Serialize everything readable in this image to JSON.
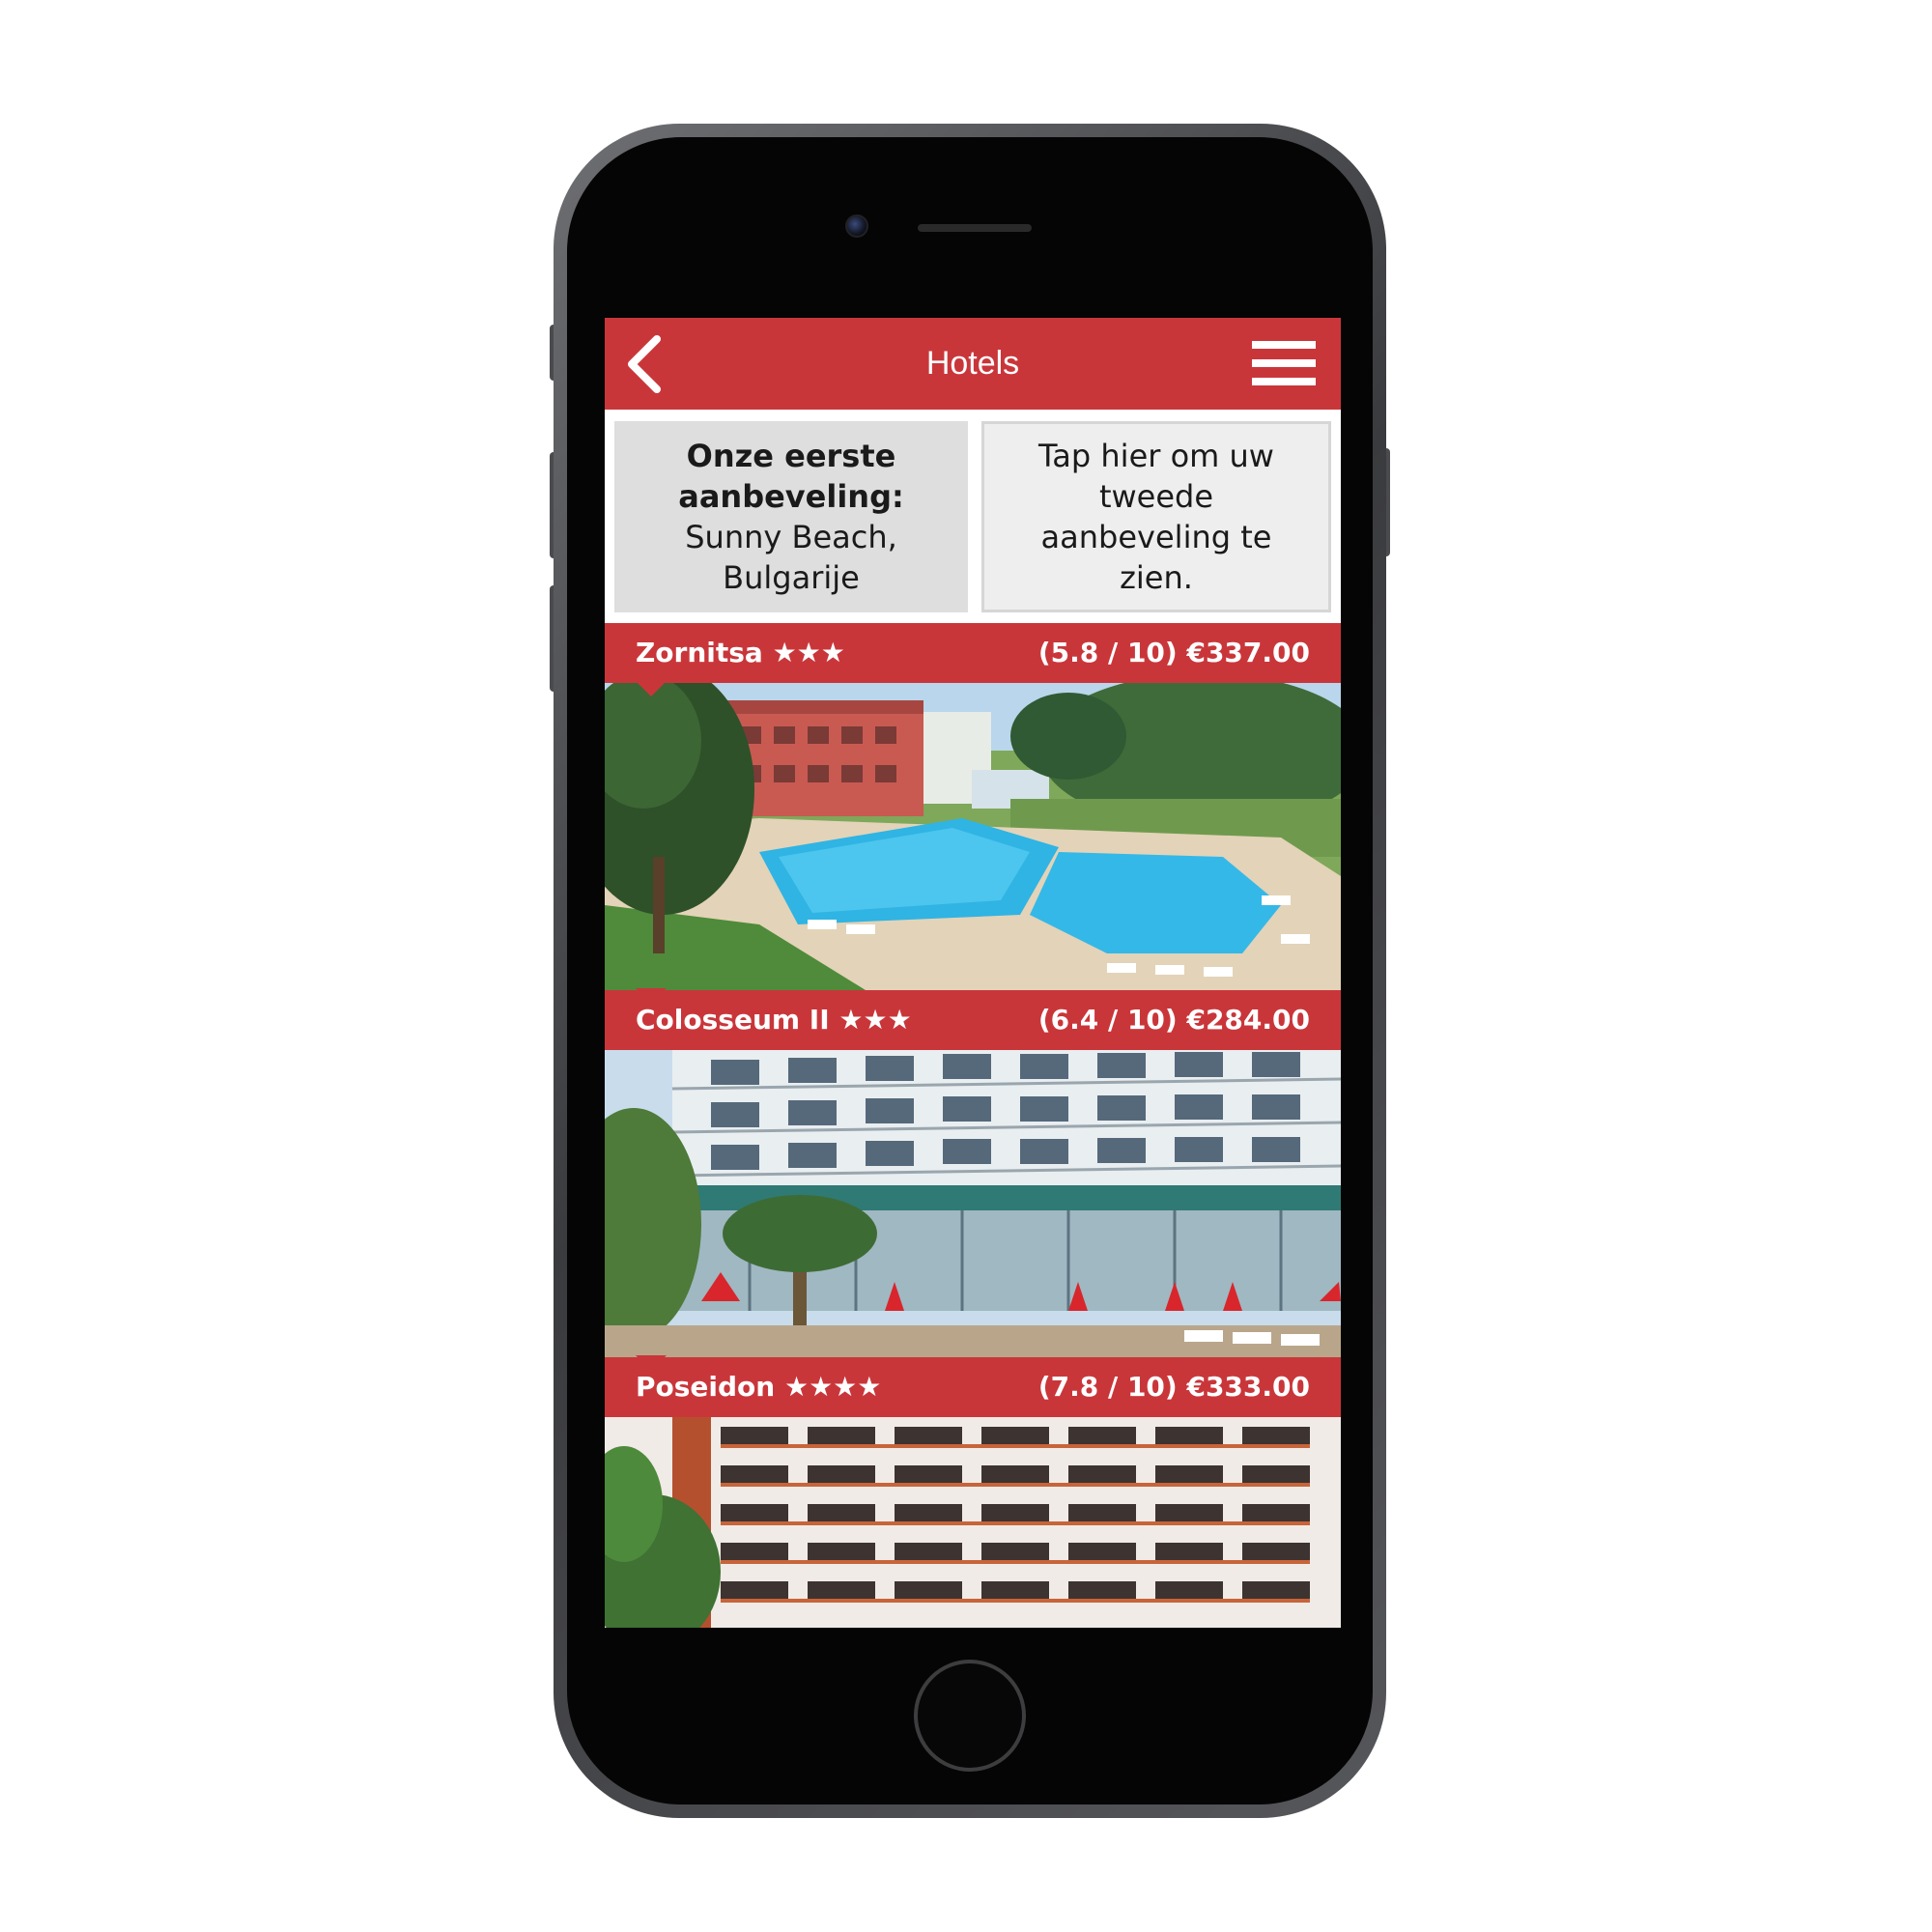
{
  "app": {
    "nav_title": "Hotels"
  },
  "recommendations": {
    "first_heading": "Onze eerste aanbeveling:",
    "first_destination": "Sunny Beach, Bulgarije",
    "second_prompt": "Tap hier om uw tweede aanbeveling te zien."
  },
  "hotels": [
    {
      "name": "Zornitsa ★★★",
      "rating_price": "(5.8 / 10) €337.00",
      "image": "pool-photo"
    },
    {
      "name": "Colosseum II ★★★",
      "rating_price": "(6.4 / 10) €284.00",
      "image": "facade-photo"
    },
    {
      "name": "Poseidon ★★★★",
      "rating_price": "(7.8 / 10) €333.00",
      "image": "tower-photo"
    }
  ],
  "colors": {
    "brand_red": "#c9363a",
    "rec_first_bg": "#dedede",
    "rec_second_bg": "#eeeeee"
  },
  "icons": {
    "back": "chevron-left-icon",
    "menu": "hamburger-menu-icon"
  }
}
